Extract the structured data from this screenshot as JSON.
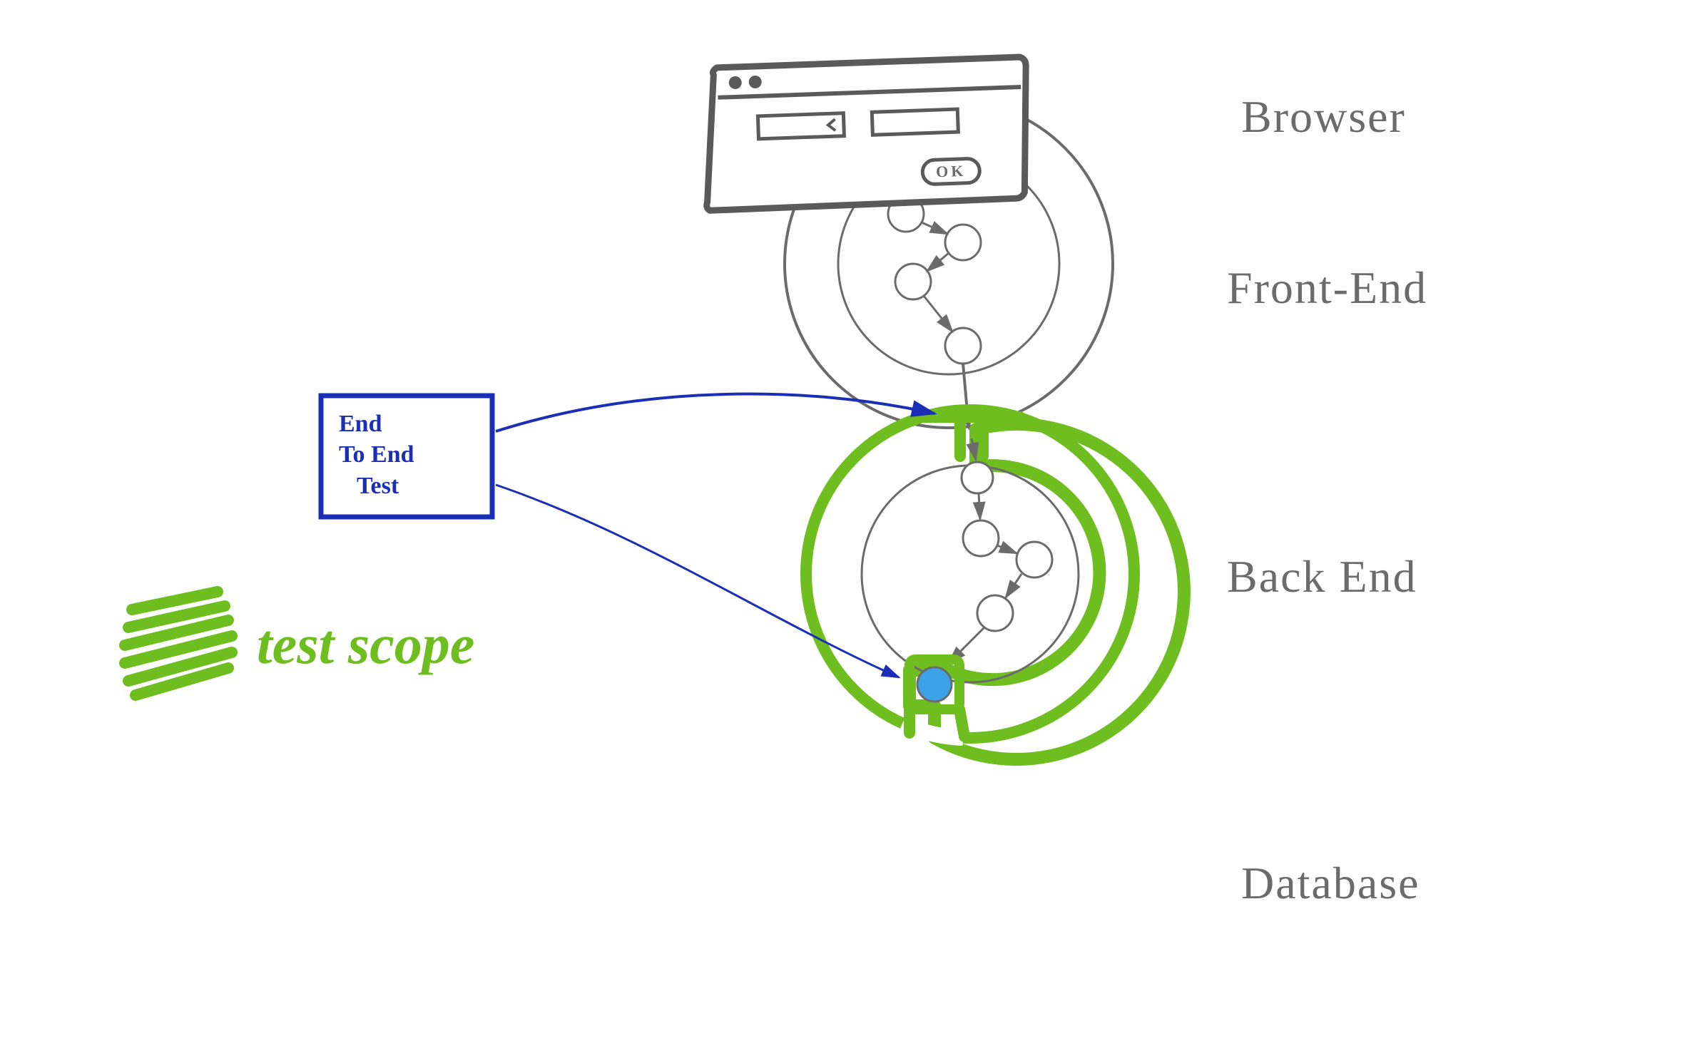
{
  "layers": {
    "browser": "Browser",
    "frontend": "Front-End",
    "backend": "Back End",
    "database": "Database"
  },
  "test_box": {
    "line1": "End",
    "line2": "To End",
    "line3": "Test"
  },
  "legend": {
    "scope": "test scope"
  },
  "browser_window": {
    "button_label": "OK"
  },
  "colors": {
    "scope_green": "#6fbe1f",
    "box_blue": "#1a2fb5",
    "sketch_grey": "#6b6b6b",
    "db_fill": "#3da3e8"
  }
}
